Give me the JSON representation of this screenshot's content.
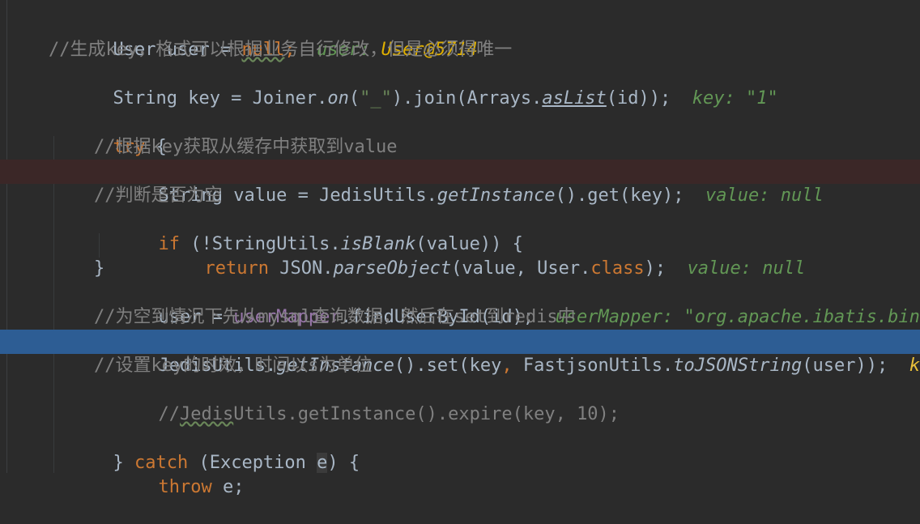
{
  "lines": {
    "l1": {
      "code_a": "User user = ",
      "code_null": "null",
      "code_b": ";  ",
      "hint_label": "user: ",
      "hint_value": "User@5714"
    },
    "l2": {
      "comment": "//生成key，格式可以根据业务自行修改，但是必须得唯一"
    },
    "l3": {
      "code_a": "String key = Joiner.",
      "on": "on",
      "paren_open": "(",
      "str": "\"_\"",
      "code_b": ").join(Arrays.",
      "aslist": "asList",
      "code_c": "(id));  ",
      "hint": "key: \"1\""
    },
    "l4": {
      "try": "try",
      "brace": " {"
    },
    "l5": {
      "comment": "//根据key获取从缓存中获取到value"
    },
    "l6": {
      "code_a": "String value = JedisUtils.",
      "method": "getInstance",
      "code_b": "().get(key);  ",
      "hint": "value: null"
    },
    "l7": {
      "comment": "//判断是否为空"
    },
    "l8": {
      "if": "if",
      "code_a": " (!StringUtils.",
      "method": "isBlank",
      "code_b": "(value)) {"
    },
    "l9": {
      "return": "return",
      "code_a": " JSON.",
      "method": "parseObject",
      "code_b": "(value, User.",
      "class": "class",
      "code_c": ");  ",
      "hint": "value: null"
    },
    "l10": {
      "code": "}"
    },
    "l11": {
      "code_a": "user = ",
      "field": "userMapper",
      "code_b": ".findUserById(id);  ",
      "hint": "userMapper: \"org.apache.ibatis.bindi"
    },
    "l12": {
      "comment": "//为空到情况下先从mysql查询数据，然后在set到redis中"
    },
    "l13": {
      "code_a": "JedisUtils.",
      "method1": "getInstance",
      "code_b": "().set(key",
      "comma": ",",
      "code_c": " FastjsonUtils.",
      "method2": "toJSONString",
      "code_d": "(user));  ",
      "hint": "key"
    },
    "l14": {
      "comment": "//设置key的时效，时间以s为单位"
    },
    "l15": {
      "comment_a": "//",
      "comment_word": "Jedis",
      "comment_b": "Utils.getInstance().expire(key, 10);"
    },
    "l17": {
      "brace": "} ",
      "catch": "catch",
      "code_a": " (Exception ",
      "e": "e",
      "code_b": ") {"
    },
    "l18": {
      "throw": "throw",
      "code": " e;"
    }
  }
}
